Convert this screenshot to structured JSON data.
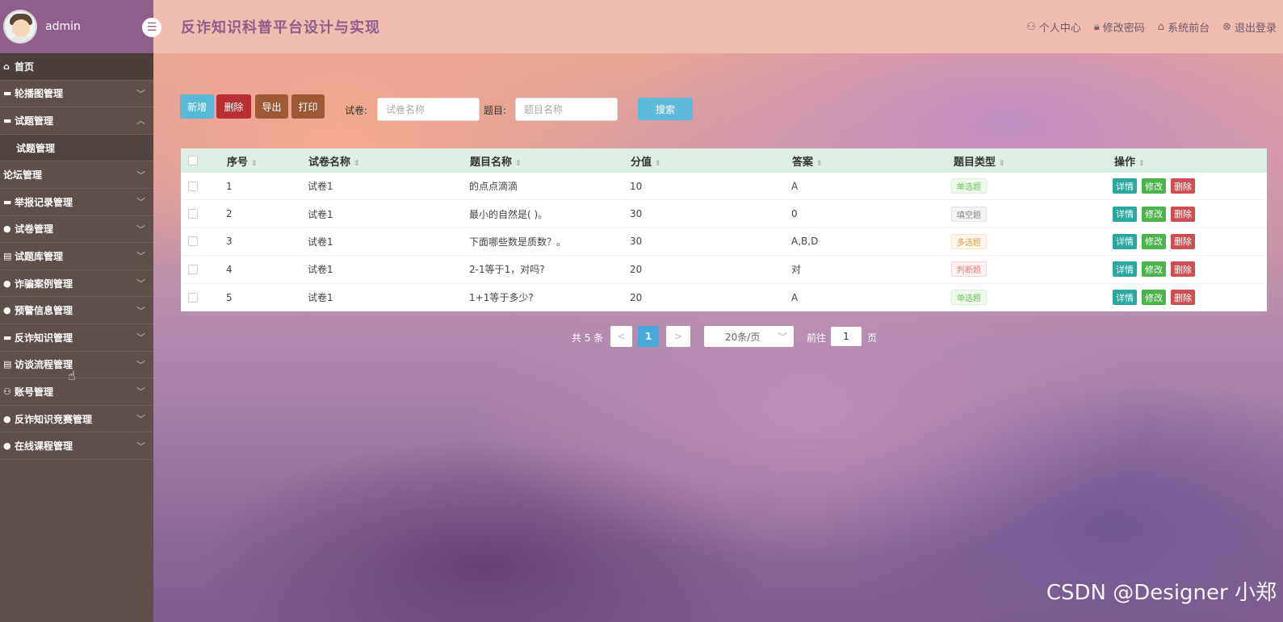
{
  "header": {
    "user": "admin",
    "title": "反诈知识科普平台设计与实现",
    "links": [
      {
        "label": "个人中心",
        "icon": "user-icon"
      },
      {
        "label": "修改密码",
        "icon": "lock-icon"
      },
      {
        "label": "系统前台",
        "icon": "home-icon"
      },
      {
        "label": "退出登录",
        "icon": "close-circle-icon"
      }
    ]
  },
  "sidebar": {
    "items": [
      {
        "label": "首页",
        "icon": "home-icon"
      },
      {
        "label": "轮播图管理"
      },
      {
        "label": "试题管理"
      },
      {
        "label": "试题管理"
      },
      {
        "label": "论坛管理"
      },
      {
        "label": "举报记录管理"
      },
      {
        "label": "试卷管理"
      },
      {
        "label": "试题库管理"
      },
      {
        "label": "诈骗案例管理"
      },
      {
        "label": "预警信息管理"
      },
      {
        "label": "反诈知识管理"
      },
      {
        "label": "访谈流程管理"
      },
      {
        "label": "账号管理"
      },
      {
        "label": "反诈知识竞赛管理"
      },
      {
        "label": "在线课程管理"
      }
    ]
  },
  "toolbar": {
    "add": "新增",
    "delete": "删除",
    "export": "导出",
    "print": "打印",
    "paper_label": "试卷:",
    "paper_placeholder": "试卷名称",
    "question_label": "题目:",
    "question_placeholder": "题目名称",
    "search": "搜索"
  },
  "table": {
    "columns": [
      "序号",
      "试卷名称",
      "题目名称",
      "分值",
      "答案",
      "题目类型",
      "操作"
    ],
    "rows": [
      {
        "no": "1",
        "paper": "试卷1",
        "question": "的点点滴滴",
        "score": "10",
        "answer": "A",
        "type": "单选题"
      },
      {
        "no": "2",
        "paper": "试卷1",
        "question": "最小的自然是( )。",
        "score": "30",
        "answer": "0",
        "type": "填空题"
      },
      {
        "no": "3",
        "paper": "试卷1",
        "question": "下面哪些数是质数？。",
        "score": "30",
        "answer": "A,B,D",
        "type": "多选题"
      },
      {
        "no": "4",
        "paper": "试卷1",
        "question": "2-1等于1，对吗?",
        "score": "20",
        "answer": "对",
        "type": "判断题"
      },
      {
        "no": "5",
        "paper": "试卷1",
        "question": "1+1等于多少?",
        "score": "20",
        "answer": "A",
        "type": "单选题"
      }
    ],
    "actions": {
      "detail": "详情",
      "edit": "修改",
      "delete": "删除"
    }
  },
  "pagination": {
    "total": "共 5 条",
    "prev": "<",
    "current": "1",
    "next": ">",
    "page_size": "20条/页",
    "goto": "前往",
    "goto_value": "1",
    "page_unit": "页"
  },
  "watermark": "CSDN @Designer 小郑"
}
